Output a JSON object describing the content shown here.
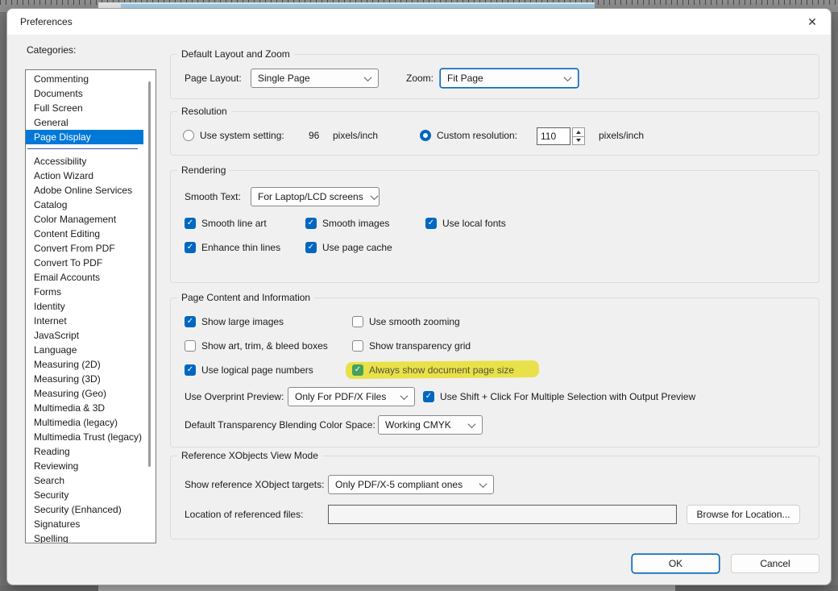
{
  "window": {
    "title": "Preferences",
    "close_symbol": "✕"
  },
  "categories": {
    "label": "Categories:",
    "selected": "Page Display",
    "separator_after": "Page Display",
    "items": [
      "Commenting",
      "Documents",
      "Full Screen",
      "General",
      "Page Display",
      "Accessibility",
      "Action Wizard",
      "Adobe Online Services",
      "Catalog",
      "Color Management",
      "Content Editing",
      "Convert From PDF",
      "Convert To PDF",
      "Email Accounts",
      "Forms",
      "Identity",
      "Internet",
      "JavaScript",
      "Language",
      "Measuring (2D)",
      "Measuring (3D)",
      "Measuring (Geo)",
      "Multimedia & 3D",
      "Multimedia (legacy)",
      "Multimedia Trust (legacy)",
      "Reading",
      "Reviewing",
      "Search",
      "Security",
      "Security (Enhanced)",
      "Signatures",
      "Spelling"
    ]
  },
  "layout_zoom": {
    "title": "Default Layout and Zoom",
    "page_layout_label": "Page Layout:",
    "page_layout_value": "Single Page",
    "zoom_label": "Zoom:",
    "zoom_value": "Fit Page"
  },
  "resolution": {
    "title": "Resolution",
    "system_label": "Use system setting:",
    "system_value": "96",
    "system_unit": "pixels/inch",
    "system_selected": false,
    "custom_label": "Custom resolution:",
    "custom_value": "110",
    "custom_unit": "pixels/inch",
    "custom_selected": true
  },
  "rendering": {
    "title": "Rendering",
    "smooth_text_label": "Smooth Text:",
    "smooth_text_value": "For Laptop/LCD screens",
    "checks": [
      {
        "label": "Smooth line art",
        "checked": true
      },
      {
        "label": "Smooth images",
        "checked": true
      },
      {
        "label": "Use local fonts",
        "checked": true
      },
      {
        "label": "Enhance thin lines",
        "checked": true
      },
      {
        "label": "Use page cache",
        "checked": true
      }
    ]
  },
  "page_content": {
    "title": "Page Content and Information",
    "checks": [
      {
        "label": "Show large images",
        "checked": true
      },
      {
        "label": "Use smooth zooming",
        "checked": false
      },
      {
        "label": "Show art, trim, & bleed boxes",
        "checked": false
      },
      {
        "label": "Show transparency grid",
        "checked": false
      },
      {
        "label": "Use logical page numbers",
        "checked": true
      },
      {
        "label": "Always show document page size",
        "checked": true,
        "highlighted": true
      }
    ],
    "overprint_label": "Use Overprint Preview:",
    "overprint_value": "Only For PDF/X Files",
    "shift_click_label": "Use Shift + Click For Multiple Selection with Output Preview",
    "shift_click_checked": true,
    "blend_label": "Default Transparency Blending Color Space:",
    "blend_value": "Working CMYK"
  },
  "xobjects": {
    "title": "Reference XObjects View Mode",
    "targets_label": "Show reference XObject targets:",
    "targets_value": "Only PDF/X-5 compliant ones",
    "location_label": "Location of referenced files:",
    "location_value": "",
    "browse_label": "Browse for Location..."
  },
  "footer": {
    "ok": "OK",
    "cancel": "Cancel"
  },
  "colors": {
    "accent": "#0067c0",
    "selection_blue": "#0078d7",
    "highlighter_yellow": "#e9e149",
    "highlight_checkbox_green": "#46a05e",
    "list_separator_blue": "#2b5aa0",
    "dialog_bg": "#f0f0f0",
    "titlebar_bg": "#ffffff"
  }
}
